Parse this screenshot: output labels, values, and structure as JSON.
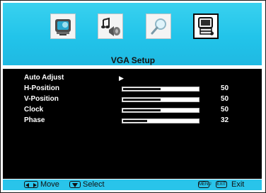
{
  "menu": {
    "title": "VGA Setup",
    "icons": [
      "picture-icon",
      "audio-icon",
      "search-icon",
      "pc-monitor-icon"
    ],
    "selected_index": 3
  },
  "settings": {
    "auto_adjust": {
      "label": "Auto Adjust",
      "indicator": "▶"
    },
    "h_position": {
      "label": "H-Position",
      "value": "50",
      "level": 0.5
    },
    "v_position": {
      "label": "V-Position",
      "value": "50",
      "level": 0.5
    },
    "clock": {
      "label": "Clock",
      "value": "50",
      "level": 0.5
    },
    "phase": {
      "label": "Phase",
      "value": "32",
      "level": 0.32
    }
  },
  "footer": {
    "move": "Move",
    "select": "Select",
    "menu_key": "MENU",
    "exit_key": "EXIT",
    "exit": "Exit"
  },
  "colors": {
    "accent": "#22c4ea",
    "panel": "#000000"
  }
}
